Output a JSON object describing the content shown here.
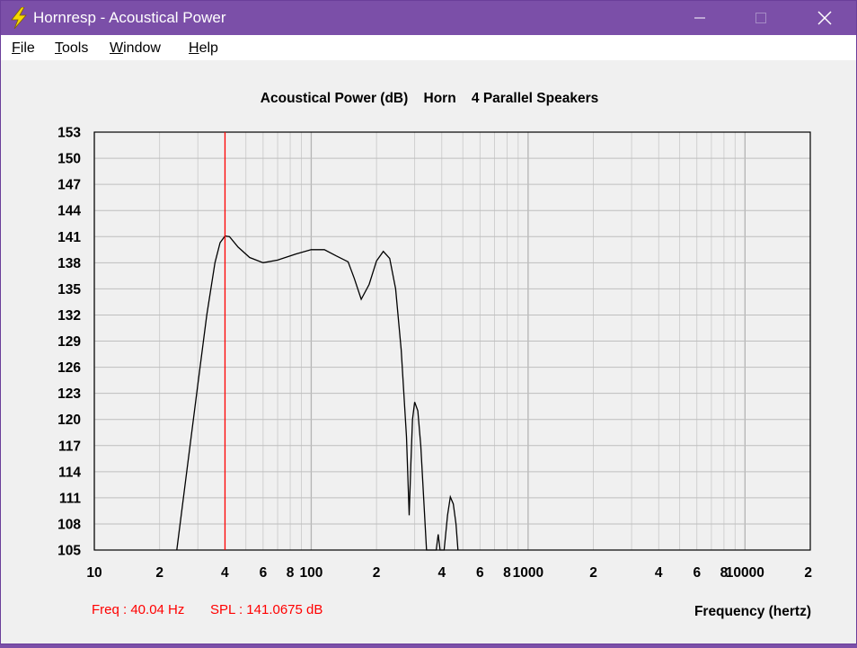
{
  "window": {
    "title": "Hornresp - Acoustical Power",
    "menu": [
      {
        "label": "File",
        "mnemonic": "F",
        "rest": "ile"
      },
      {
        "label": "Tools",
        "mnemonic": "T",
        "rest": "ools"
      },
      {
        "label": "Window",
        "mnemonic": "W",
        "rest": "indow"
      },
      {
        "label": "Help",
        "mnemonic": "H",
        "rest": "elp"
      }
    ],
    "icons": {
      "app": "lightning-icon",
      "minimize": "minimize-icon",
      "maximize": "maximize-icon",
      "close": "close-icon"
    },
    "colors": {
      "titlebar": "#7b4fa8",
      "cursor": "#ff0000",
      "status_text": "#ff0000",
      "curve": "#000000",
      "grid": "#c8c8c8"
    }
  },
  "chart_data": {
    "type": "line",
    "title": "Acoustical Power (dB)    Horn    4 Parallel Speakers",
    "xlabel": "Frequency (hertz)",
    "ylabel": "",
    "x_scale": "log",
    "xlim": [
      10,
      20000
    ],
    "ylim": [
      105,
      153
    ],
    "y_ticks": [
      153,
      150,
      147,
      144,
      141,
      138,
      135,
      132,
      129,
      126,
      123,
      120,
      117,
      114,
      111,
      108,
      105
    ],
    "x_tick_labels": [
      {
        "value": 10,
        "label": "10"
      },
      {
        "value": 20,
        "label": "2"
      },
      {
        "value": 40,
        "label": "4"
      },
      {
        "value": 60,
        "label": "6"
      },
      {
        "value": 80,
        "label": "8"
      },
      {
        "value": 100,
        "label": "100"
      },
      {
        "value": 200,
        "label": "2"
      },
      {
        "value": 400,
        "label": "4"
      },
      {
        "value": 600,
        "label": "6"
      },
      {
        "value": 800,
        "label": "8"
      },
      {
        "value": 1000,
        "label": "1000"
      },
      {
        "value": 2000,
        "label": "2"
      },
      {
        "value": 4000,
        "label": "4"
      },
      {
        "value": 6000,
        "label": "6"
      },
      {
        "value": 8000,
        "label": "8"
      },
      {
        "value": 10000,
        "label": "10000"
      },
      {
        "value": 20000,
        "label": "2"
      }
    ],
    "cursor": {
      "freq": 40.04
    },
    "status": {
      "freq_text": "Freq : 40.04 Hz",
      "spl_text": "SPL : 141.0675 dB"
    },
    "series": [
      {
        "values_xy": [
          [
            24.0,
            105
          ],
          [
            27.0,
            115
          ],
          [
            30.0,
            124
          ],
          [
            33.0,
            132
          ],
          [
            36.0,
            138
          ],
          [
            38.0,
            140.3
          ],
          [
            40.04,
            141.07
          ],
          [
            42.0,
            141.0
          ],
          [
            46.0,
            139.8
          ],
          [
            52.0,
            138.6
          ],
          [
            60.0,
            138.0
          ],
          [
            70.0,
            138.3
          ],
          [
            85.0,
            139.0
          ],
          [
            100.0,
            139.5
          ],
          [
            115.0,
            139.5
          ],
          [
            130.0,
            138.8
          ],
          [
            148.0,
            138.1
          ],
          [
            158.0,
            136.2
          ],
          [
            170.0,
            133.8
          ],
          [
            185.0,
            135.5
          ],
          [
            200.0,
            138.2
          ],
          [
            215.0,
            139.3
          ],
          [
            230.0,
            138.5
          ],
          [
            245.0,
            135.0
          ],
          [
            260.0,
            128.0
          ],
          [
            275.0,
            118.0
          ],
          [
            283.0,
            109.0
          ],
          [
            288.0,
            115.0
          ],
          [
            293.0,
            120.0
          ],
          [
            300.0,
            122.0
          ],
          [
            310.0,
            121.0
          ],
          [
            320.0,
            117.0
          ],
          [
            330.0,
            111.0
          ],
          [
            340.0,
            105.0
          ],
          [
            377.0,
            105.0
          ],
          [
            385.0,
            106.8
          ],
          [
            393.0,
            105.0
          ],
          [
            410.0,
            105.0
          ],
          [
            425.0,
            109.0
          ],
          [
            438.0,
            111.1
          ],
          [
            452.0,
            110.3
          ],
          [
            465.0,
            108.0
          ],
          [
            475.0,
            105.0
          ]
        ]
      }
    ],
    "grid": true
  }
}
